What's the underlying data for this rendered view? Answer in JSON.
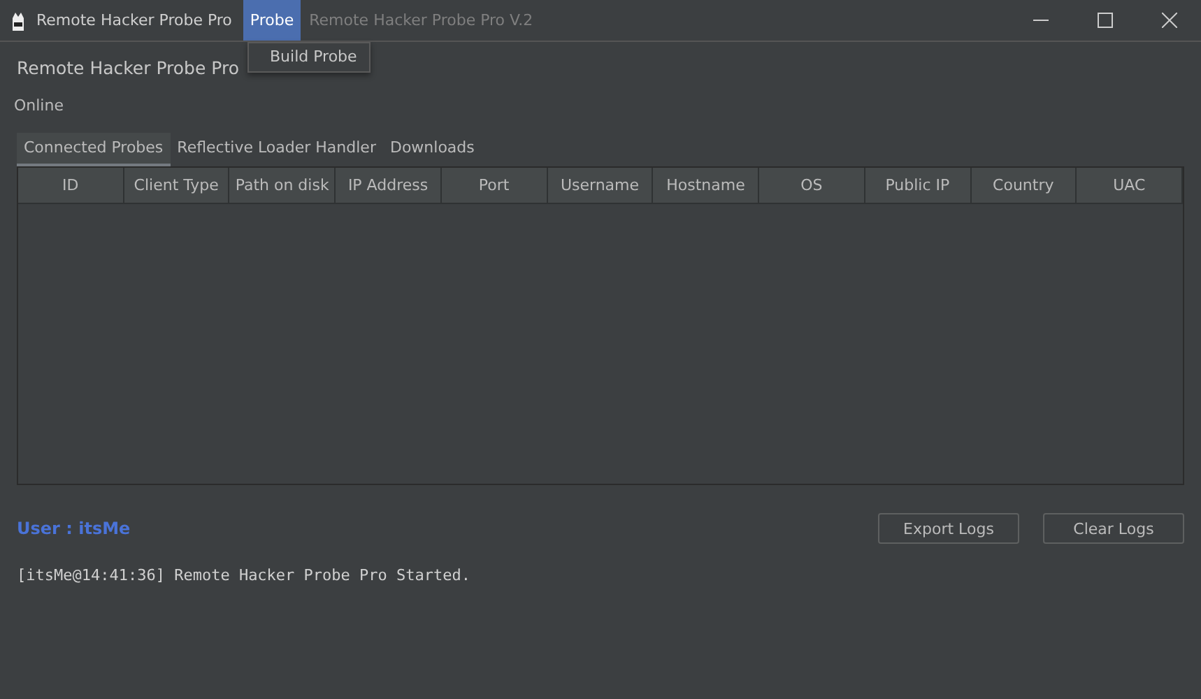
{
  "window": {
    "title": "Remote Hacker Probe Pro",
    "subtitle": "Remote Hacker Probe Pro V.2"
  },
  "menu": [
    {
      "label": "Probe",
      "selected": true
    }
  ],
  "dropdown": {
    "items": [
      "Build Probe"
    ]
  },
  "heading": "Remote Hacker Probe Pro",
  "status": "Online",
  "tabs": [
    {
      "label": "Connected Probes",
      "selected": true
    },
    {
      "label": "Reflective Loader Handler",
      "selected": false
    },
    {
      "label": "Downloads",
      "selected": false
    }
  ],
  "table": {
    "columns": [
      "ID",
      "Client Type",
      "Path on disk",
      "IP Address",
      "Port",
      "Username",
      "Hostname",
      "OS",
      "Public IP",
      "Country",
      "UAC"
    ]
  },
  "user_label": "User : itsMe",
  "buttons": [
    "Export Logs",
    "Clear Logs"
  ],
  "log": [
    "[itsMe@14:41:36] Remote Hacker Probe Pro Started."
  ]
}
